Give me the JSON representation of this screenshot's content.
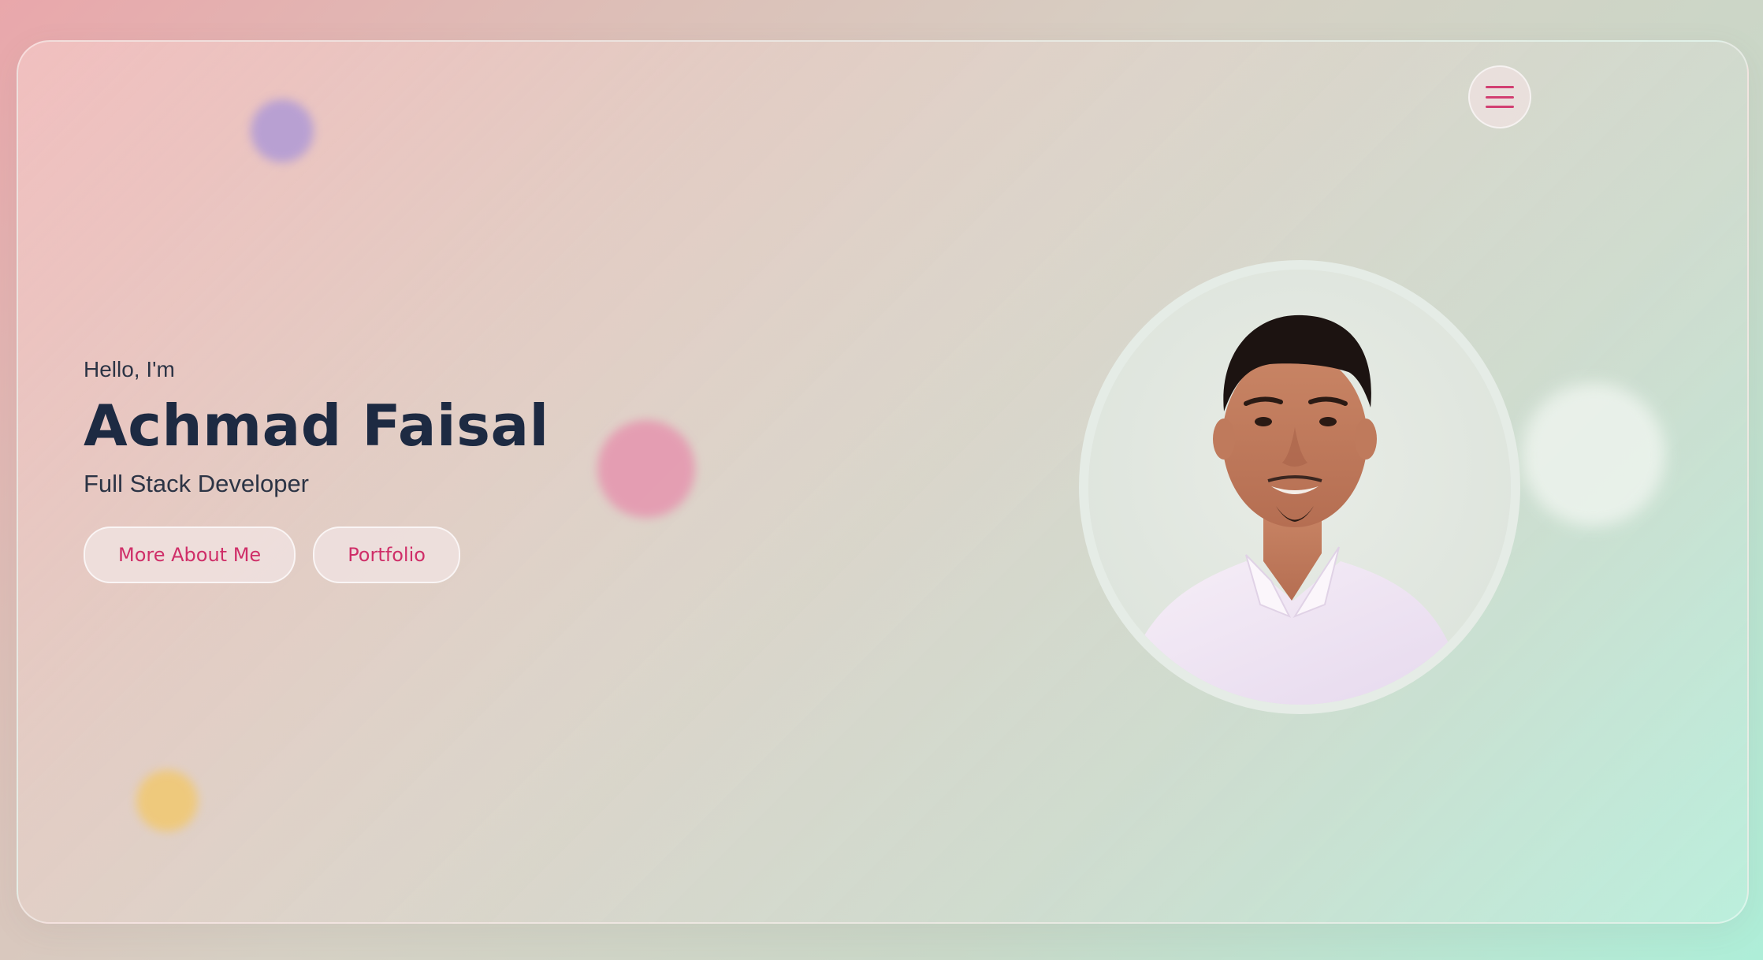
{
  "hero": {
    "greeting": "Hello, I'm",
    "name": "Achmad Faisal",
    "role": "Full Stack Developer",
    "buttons": {
      "more_about": "More About Me",
      "portfolio": "Portfolio"
    }
  },
  "nav": {
    "menu_icon": "hamburger-menu-icon"
  },
  "colors": {
    "accent": "#d23f72",
    "heading": "#1d2a42",
    "text": "#2c3445"
  }
}
